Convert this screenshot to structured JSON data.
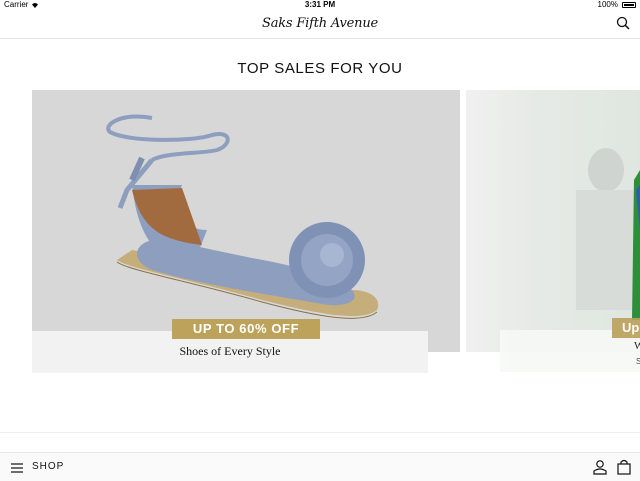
{
  "status_bar": {
    "carrier": "Carrier",
    "time": "3:31 PM",
    "battery": "100%"
  },
  "header": {
    "logo_text": "Saks Fifth Avenue"
  },
  "section": {
    "title": "TOP SALES FOR YOU"
  },
  "carousel": {
    "cards": [
      {
        "image": "blue-espadrille-pompom-sandal",
        "badge": "UP TO 60% OFF",
        "subtitle": "Shoes of Every Style"
      },
      {
        "image": "fashion-model-partial",
        "badge": "Up",
        "subtitle": "W",
        "subtitle2": "S"
      }
    ]
  },
  "bottom_nav": {
    "shop_label": "SHOP"
  },
  "colors": {
    "badge_gold": "#bca25a",
    "card_gray": "#d7d7d7",
    "sandal_blue": "#8d9ebf",
    "jute": "#c5ae7a"
  }
}
